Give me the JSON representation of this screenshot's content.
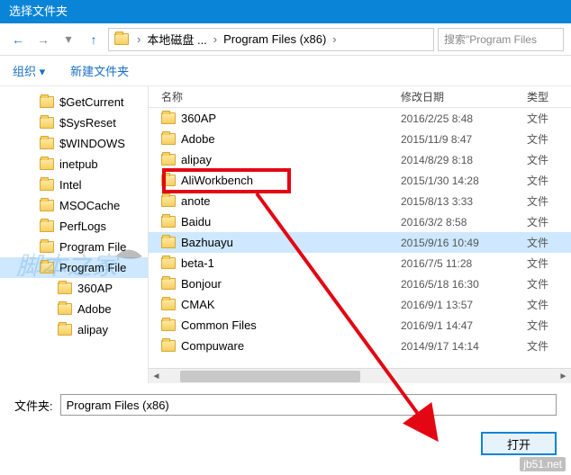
{
  "window": {
    "title": "选择文件夹"
  },
  "nav": {
    "crumbs": [
      "本地磁盘 ...",
      "Program Files (x86)"
    ],
    "search_placeholder": "搜索\"Program Files"
  },
  "toolbar": {
    "organize": "组织 ▾",
    "newfolder": "新建文件夹"
  },
  "tree": {
    "items": [
      {
        "label": "$GetCurrent",
        "indent": false,
        "sel": false
      },
      {
        "label": "$SysReset",
        "indent": false,
        "sel": false
      },
      {
        "label": "$WINDOWS",
        "indent": false,
        "sel": false
      },
      {
        "label": "inetpub",
        "indent": false,
        "sel": false
      },
      {
        "label": "Intel",
        "indent": false,
        "sel": false
      },
      {
        "label": "MSOCache",
        "indent": false,
        "sel": false
      },
      {
        "label": "PerfLogs",
        "indent": false,
        "sel": false
      },
      {
        "label": "Program File",
        "indent": false,
        "sel": false
      },
      {
        "label": "Program File",
        "indent": false,
        "sel": true
      },
      {
        "label": "360AP",
        "indent": true,
        "sel": false
      },
      {
        "label": "Adobe",
        "indent": true,
        "sel": false
      },
      {
        "label": "alipay",
        "indent": true,
        "sel": false
      }
    ]
  },
  "columns": {
    "name": "名称",
    "date": "修改日期",
    "type": "类型"
  },
  "rows": [
    {
      "name": "360AP",
      "date": "2016/2/25 8:48",
      "type": "文件",
      "sel": false
    },
    {
      "name": "Adobe",
      "date": "2015/11/9 8:47",
      "type": "文件",
      "sel": false
    },
    {
      "name": "alipay",
      "date": "2014/8/29 8:18",
      "type": "文件",
      "sel": false
    },
    {
      "name": "AliWorkbench",
      "date": "2015/1/30 14:28",
      "type": "文件",
      "sel": false
    },
    {
      "name": "anote",
      "date": "2015/8/13 3:33",
      "type": "文件",
      "sel": false
    },
    {
      "name": "Baidu",
      "date": "2016/3/2 8:58",
      "type": "文件",
      "sel": false
    },
    {
      "name": "Bazhuayu",
      "date": "2015/9/16 10:49",
      "type": "文件",
      "sel": true
    },
    {
      "name": "beta-1",
      "date": "2016/7/5 11:28",
      "type": "文件",
      "sel": false
    },
    {
      "name": "Bonjour",
      "date": "2016/5/18 16:30",
      "type": "文件",
      "sel": false
    },
    {
      "name": "CMAK",
      "date": "2016/9/1 13:57",
      "type": "文件",
      "sel": false
    },
    {
      "name": "Common Files",
      "date": "2016/9/1 14:47",
      "type": "文件",
      "sel": false
    },
    {
      "name": "Compuware",
      "date": "2014/9/17 14:14",
      "type": "文件",
      "sel": false
    }
  ],
  "footer": {
    "label": "文件夹:",
    "value": "Program Files (x86)",
    "button": "打开"
  },
  "watermark": "jb51.net"
}
